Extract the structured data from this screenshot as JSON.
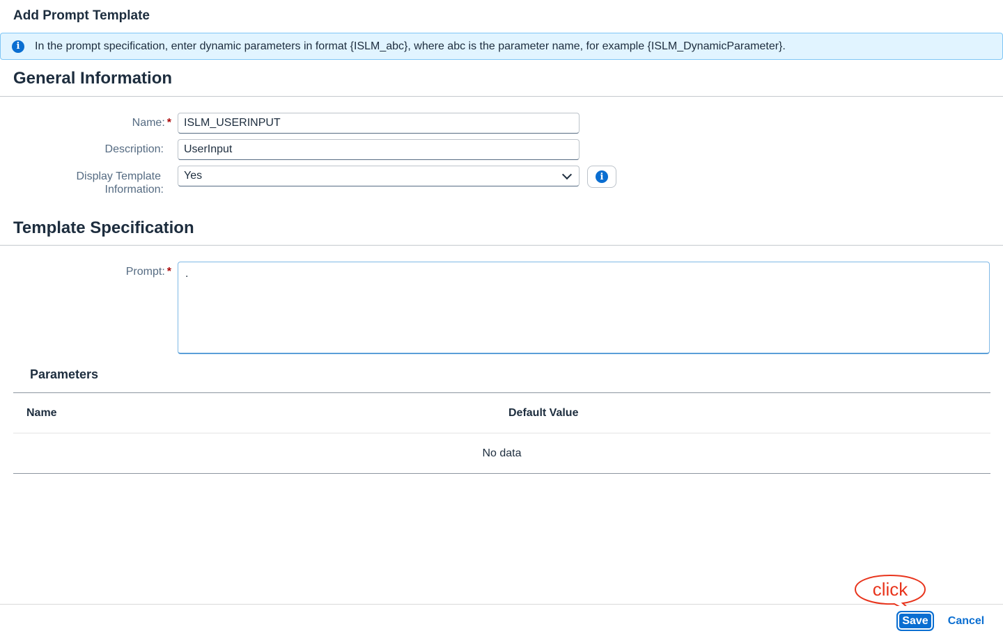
{
  "dialog": {
    "title": "Add Prompt Template",
    "info_message": "In the prompt specification, enter dynamic parameters in format {ISLM_abc}, where abc is the parameter name, for example {ISLM_DynamicParameter}."
  },
  "general": {
    "section_title": "General Information",
    "name_label": "Name:",
    "name_value": "ISLM_USERINPUT",
    "description_label": "Description:",
    "description_value": "UserInput",
    "display_label_line1": "Display Template",
    "display_label_line2": "Information:",
    "display_value": "Yes",
    "required_mark": "*"
  },
  "template": {
    "section_title": "Template Specification",
    "prompt_label": "Prompt:",
    "prompt_value": "."
  },
  "parameters": {
    "title": "Parameters",
    "columns": [
      "Name",
      "Default Value"
    ],
    "empty_text": "No data"
  },
  "footer": {
    "save_label": "Save",
    "cancel_label": "Cancel"
  },
  "annotation": {
    "callout_text": "click"
  },
  "colors": {
    "accent": "#0a6ed1",
    "info_bg": "#e1f4ff",
    "required": "#aa0808",
    "callout": "#e8341c"
  },
  "icons": {
    "info": "info-icon",
    "dropdown": "chevron-down-icon"
  }
}
